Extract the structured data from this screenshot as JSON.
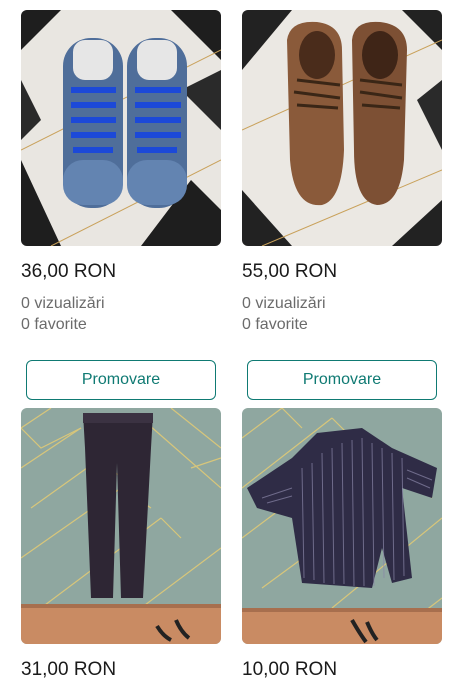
{
  "listings": [
    {
      "price": "36,00 RON",
      "views": "0 vizualizări",
      "favorites": "0 favorite",
      "promote_label": "Promovare",
      "image": "blue-sneakers"
    },
    {
      "price": "55,00 RON",
      "views": "0 vizualizări",
      "favorites": "0 favorite",
      "promote_label": "Promovare",
      "image": "brown-dress-shoes"
    },
    {
      "price": "31,00 RON",
      "image": "dark-trousers"
    },
    {
      "price": "10,00 RON",
      "image": "striped-shirt"
    }
  ],
  "colors": {
    "accent": "#0f7a73",
    "muted_text": "#6b6b6b"
  }
}
